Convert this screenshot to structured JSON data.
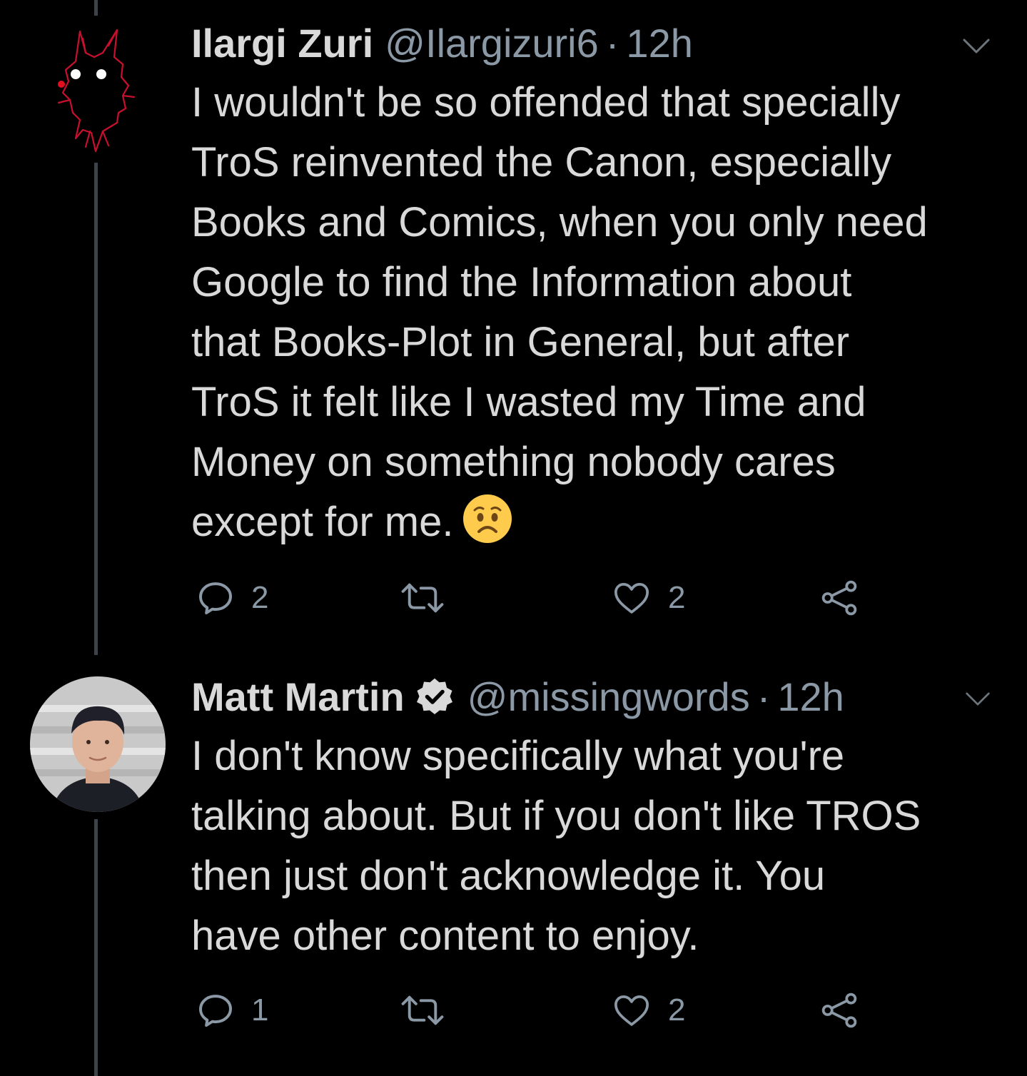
{
  "tweets": [
    {
      "name": "Ilargi Zuri",
      "handle": "@Ilargizuri6",
      "separator": "·",
      "time": "12h",
      "verified": false,
      "avatar": "wolf-sketch-avatar",
      "text_lines": [
        "I wouldn't be so offended that specially",
        "TroS reinvented the Canon, especially",
        "Books and Comics, when you only need",
        "Google to find the Information about",
        "that Books-Plot in General, but after",
        "TroS it felt like I wasted my Time and",
        "Money on something nobody cares",
        "except for me."
      ],
      "emoji": "worried-face-emoji",
      "actions": {
        "reply_count": "2",
        "retweet_count": "",
        "like_count": "2"
      }
    },
    {
      "name": "Matt Martin",
      "handle": "@missingwords",
      "separator": "·",
      "time": "12h",
      "verified": true,
      "avatar": "profile-photo-avatar",
      "text_lines": [
        "I don't know specifically what you're",
        "talking about. But if you don't like TROS",
        "then just don't acknowledge it. You",
        "have other content to enjoy."
      ],
      "actions": {
        "reply_count": "1",
        "retweet_count": "",
        "like_count": "2"
      }
    }
  ],
  "colors": {
    "background": "#000000",
    "text_primary": "#d9d9d9",
    "text_secondary": "#8b98a5",
    "thread_line": "#3d4349",
    "wolf_outline": "#c8102e"
  },
  "icons": [
    "reply-icon",
    "retweet-icon",
    "like-icon",
    "share-icon",
    "chevron-down-icon",
    "verified-badge-icon"
  ]
}
